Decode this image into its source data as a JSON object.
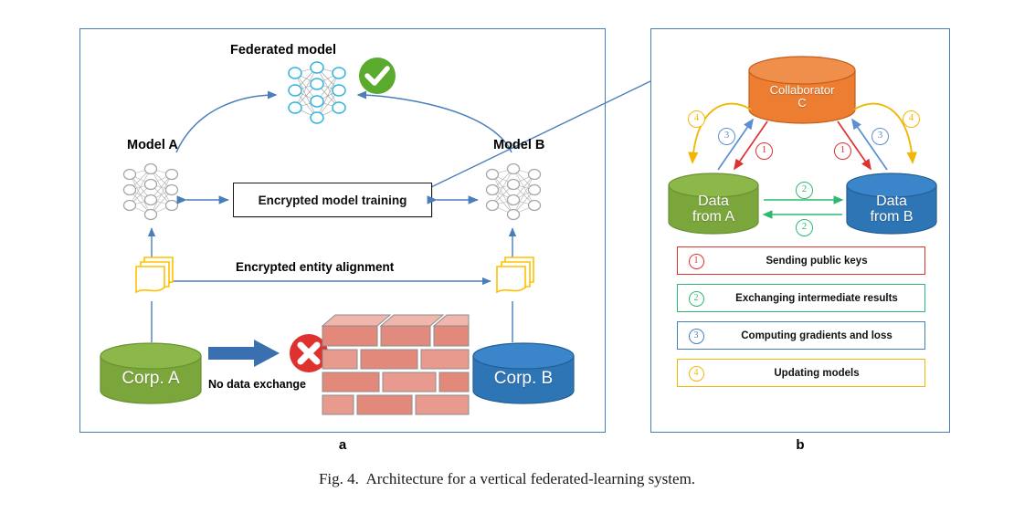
{
  "caption": "Fig. 4.  Architecture for a vertical federated-learning system.",
  "panels": {
    "a": {
      "label": "a",
      "federated_title": "Federated model",
      "model_a_title": "Model A",
      "model_b_title": "Model B",
      "encrypted_training": "Encrypted model training",
      "encrypted_alignment": "Encrypted entity alignment",
      "no_exchange": "No data exchange",
      "corp_a": "Corp. A",
      "corp_b": "Corp. B"
    },
    "b": {
      "label": "b",
      "collaborator": "Collaborator\nC",
      "data_a": "Data\nfrom A",
      "data_b": "Data\nfrom B",
      "steps": [
        {
          "num": "1",
          "text": "Sending public keys",
          "color": "#e03131"
        },
        {
          "num": "2",
          "text": "Exchanging  intermediate results",
          "color": "#2eb872"
        },
        {
          "num": "3",
          "text": "Computing gradients and loss",
          "color": "#4a7ebb"
        },
        {
          "num": "4",
          "text": "Updating models",
          "color": "#f2b705"
        }
      ],
      "arrow_marks": {
        "left_four": "4",
        "left_three": "3",
        "left_one": "1",
        "right_one": "1",
        "right_three": "3",
        "right_four": "4",
        "exchange_top": "2",
        "exchange_bottom": "2"
      }
    }
  },
  "colors": {
    "panel_border": "#4a7ebb",
    "green_cylinder": "#7ba63c",
    "blue_cylinder": "#2e75b6",
    "orange_cylinder": "#ed7d31",
    "arrow_blue": "#4a7ebb",
    "doc_yellow": "#ffc000",
    "brick_red": "#e08b7e",
    "check_green": "#5aab2d",
    "x_red": "#e03131",
    "net_cyan": "#2fb4e0",
    "net_gray": "#a6a6a6"
  }
}
